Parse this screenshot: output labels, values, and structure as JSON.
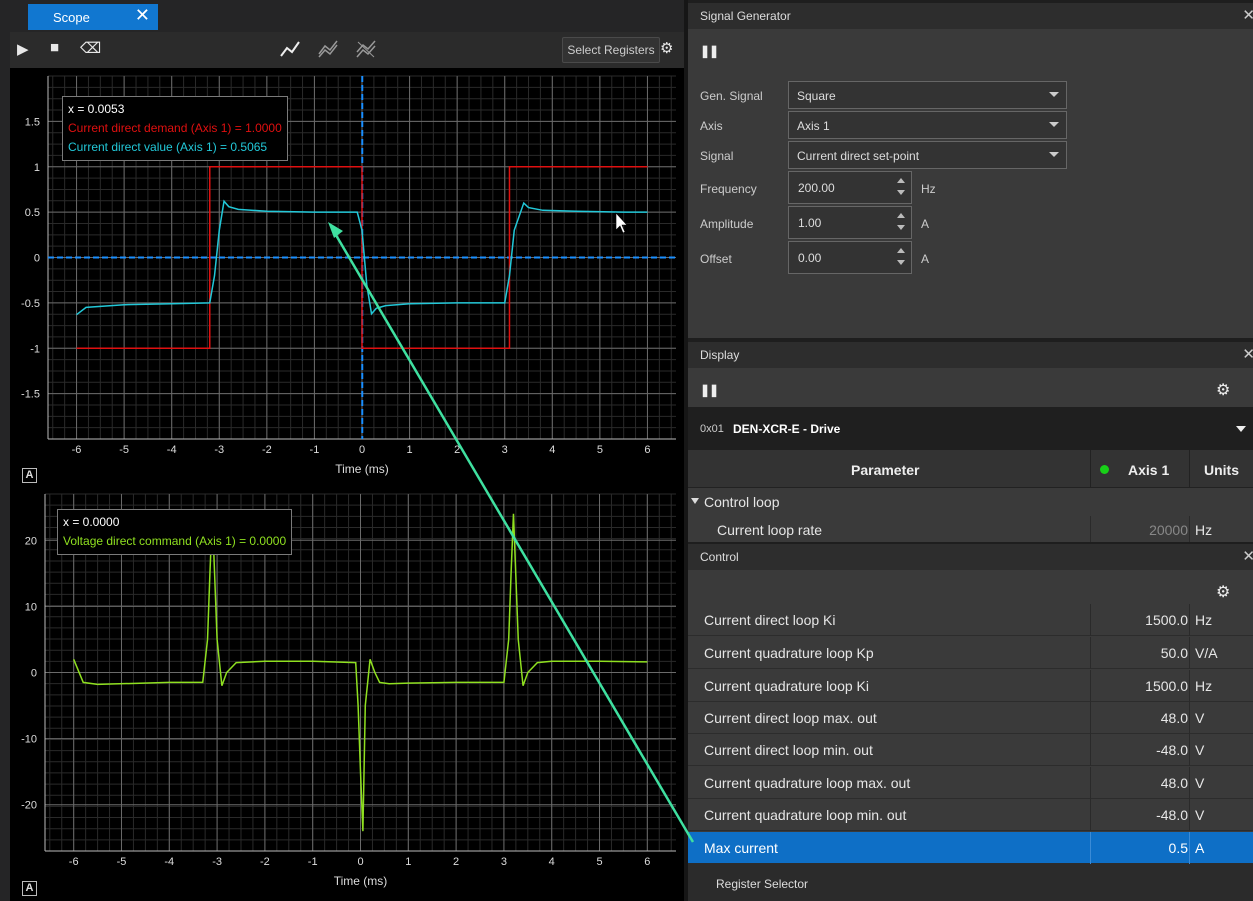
{
  "scope": {
    "tab_label": "Scope",
    "select_registers_label": "Select Registers",
    "top_plot": {
      "tooltip": {
        "x": "x = 0.0053",
        "series1": "Current direct demand (Axis 1) = 1.0000",
        "series2": "Current direct value (Axis 1) = 0.5065"
      },
      "xlabel": "Time (ms)",
      "y_ticks": [
        "1.5",
        "1",
        "0.5",
        "0",
        "-0.5",
        "-1",
        "-1.5"
      ],
      "x_ticks": [
        "-6",
        "-5",
        "-4",
        "-3",
        "-2",
        "-1",
        "0",
        "1",
        "2",
        "3",
        "4",
        "5",
        "6"
      ]
    },
    "bottom_plot": {
      "tooltip": {
        "x": "x = 0.0000",
        "series1": "Voltage direct command (Axis 1) = 0.0000"
      },
      "xlabel": "Time (ms)",
      "y_ticks": [
        "20",
        "10",
        "0",
        "-10",
        "-20"
      ],
      "x_ticks": [
        "-6",
        "-5",
        "-4",
        "-3",
        "-2",
        "-1",
        "0",
        "1",
        "2",
        "3",
        "4",
        "5",
        "6"
      ]
    },
    "colors": {
      "demand": "#e01010",
      "value": "#22c8d8",
      "voltage": "#8fe020",
      "cursor": "#1a8fff",
      "arrow": "#3fe0a0"
    }
  },
  "chart_data": [
    {
      "type": "line",
      "xlabel": "Time (ms)",
      "ylabel": "",
      "xlim": [
        -6.6,
        6.6
      ],
      "ylim": [
        -2.0,
        2.0
      ],
      "series": [
        {
          "name": "Current direct demand (Axis 1)",
          "x": [
            -6,
            -3.2,
            -3.2,
            0,
            0,
            3.1,
            3.1,
            6
          ],
          "y": [
            -1,
            -1,
            1,
            1,
            -1,
            -1,
            1,
            1
          ]
        },
        {
          "name": "Current direct value (Axis 1)",
          "x": [
            -6,
            -5.8,
            -5,
            -4,
            -3.2,
            -3.1,
            -3,
            -2.9,
            -2.8,
            -2.6,
            -2,
            -1,
            -0.1,
            0,
            0.1,
            0.2,
            0.3,
            0.5,
            1,
            2,
            3.0,
            3.1,
            3.2,
            3.4,
            3.5,
            3.8,
            4.5,
            5.5,
            6
          ],
          "y": [
            -0.63,
            -0.55,
            -0.52,
            -0.51,
            -0.5,
            -0.2,
            0.3,
            0.62,
            0.56,
            0.53,
            0.51,
            0.5,
            0.5,
            0.3,
            -0.3,
            -0.62,
            -0.56,
            -0.53,
            -0.51,
            -0.5,
            -0.5,
            -0.2,
            0.3,
            0.6,
            0.55,
            0.52,
            0.51,
            0.5,
            0.5
          ]
        }
      ],
      "cursor_x": 0.0053,
      "grid": true
    },
    {
      "type": "line",
      "xlabel": "Time (ms)",
      "ylabel": "",
      "xlim": [
        -6.6,
        6.6
      ],
      "ylim": [
        -27,
        27
      ],
      "series": [
        {
          "name": "Voltage direct command (Axis 1)",
          "x": [
            -6,
            -5.8,
            -5.5,
            -4,
            -3.3,
            -3.2,
            -3.15,
            -3.1,
            -3.0,
            -2.9,
            -2.8,
            -2.6,
            -2,
            -1,
            -0.1,
            -0.05,
            0,
            0.05,
            0.1,
            0.2,
            0.3,
            0.4,
            0.6,
            1,
            2,
            3.0,
            3.1,
            3.15,
            3.2,
            3.3,
            3.4,
            3.5,
            3.7,
            4,
            5,
            6
          ],
          "y": [
            2,
            -1.5,
            -1.8,
            -1.5,
            -1.5,
            5,
            15,
            24,
            5,
            -2,
            0,
            1.5,
            1.7,
            1.7,
            1.5,
            -5,
            -15,
            -24,
            -5,
            2,
            0,
            -1.5,
            -1.7,
            -1.6,
            -1.5,
            -1.5,
            5,
            15,
            24,
            5,
            -2,
            0,
            1.5,
            1.7,
            1.7,
            1.6
          ]
        }
      ],
      "grid": true
    }
  ],
  "signal_generator": {
    "title": "Signal Generator",
    "fields": [
      {
        "label": "Gen. Signal",
        "value": "Square"
      },
      {
        "label": "Axis",
        "value": "Axis 1"
      },
      {
        "label": "Signal",
        "value": "Current direct set-point"
      }
    ],
    "spins": [
      {
        "label": "Frequency",
        "value": "200.00",
        "unit": "Hz"
      },
      {
        "label": "Amplitude",
        "value": "1.00",
        "unit": "A"
      },
      {
        "label": "Offset",
        "value": "0.00",
        "unit": "A"
      }
    ]
  },
  "display": {
    "title": "Display",
    "device_prefix": "0x01",
    "device_name": "DEN-XCR-E - Drive",
    "header": {
      "parameter": "Parameter",
      "axis": "Axis 1",
      "units": "Units"
    },
    "group": "Control loop",
    "rows": [
      {
        "name": "Current loop rate",
        "value": "20000",
        "unit": "Hz"
      }
    ]
  },
  "control": {
    "title": "Control",
    "rows": [
      {
        "name": "Current direct loop Ki",
        "value": "1500.0",
        "unit": "Hz"
      },
      {
        "name": "Current quadrature loop Kp",
        "value": "50.0",
        "unit": "V/A"
      },
      {
        "name": "Current quadrature loop Ki",
        "value": "1500.0",
        "unit": "Hz"
      },
      {
        "name": "Current direct loop max. out",
        "value": "48.0",
        "unit": "V"
      },
      {
        "name": "Current direct loop min. out",
        "value": "-48.0",
        "unit": "V"
      },
      {
        "name": "Current quadrature loop max. out",
        "value": "48.0",
        "unit": "V"
      },
      {
        "name": "Current quadrature loop min. out",
        "value": "-48.0",
        "unit": "V"
      },
      {
        "name": "Max current",
        "value": "0.5",
        "unit": "A"
      }
    ],
    "footer": "Register Selector"
  }
}
